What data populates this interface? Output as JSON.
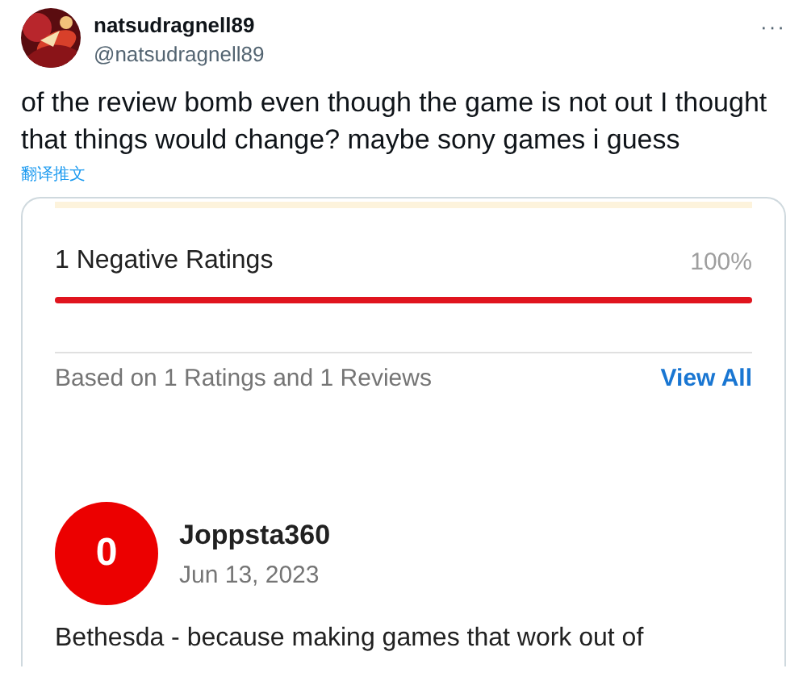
{
  "tweet": {
    "display_name": "natsudragnell89",
    "handle": "@natsudragnell89",
    "more": "···",
    "text": "of the review bomb even though the game is not out I thought that things would change? maybe sony games i guess",
    "translate": "翻译推文"
  },
  "card": {
    "rating_label": "1 Negative Ratings",
    "rating_percent": "100%",
    "level": 1,
    "summary": "Based on 1 Ratings and 1 Reviews",
    "view_all": "View All",
    "review": {
      "score": "0",
      "author": "Joppsta360",
      "date": "Jun 13, 2023",
      "body": "Bethesda - because making games that work out of"
    }
  }
}
